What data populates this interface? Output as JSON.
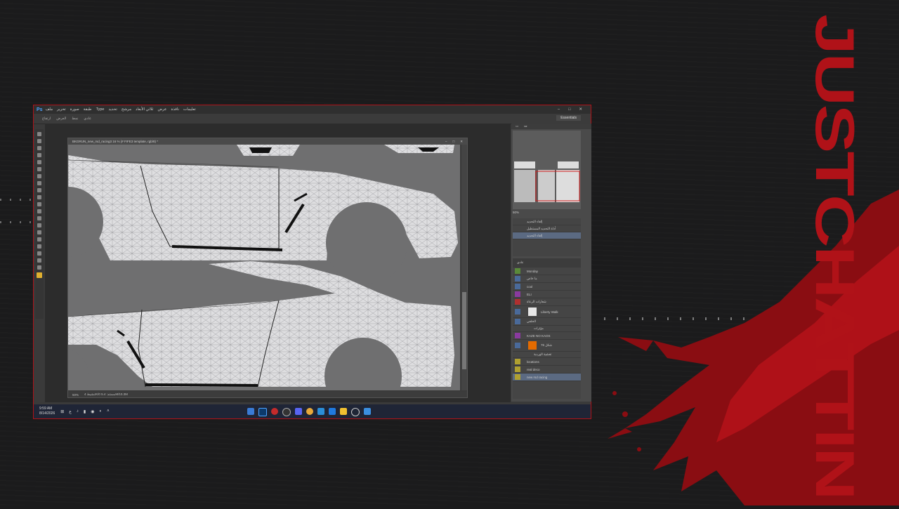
{
  "brand": {
    "text": "JUSTCHATTIN",
    "accent": "#b01218"
  },
  "photoshop": {
    "logo": "Ps",
    "menus": [
      "ملف",
      "تحرير",
      "صورة",
      "طبقة",
      "Type",
      "تحديد",
      "مرشح",
      "ثلاثي الأبعاد",
      "عرض",
      "نافذة",
      "تعليمات"
    ],
    "options": [
      "ارتفاع",
      "العرض",
      "نمط",
      "عادي"
    ],
    "workspace": "Essentials",
    "document_title": "BKGRUN_new_rsd_racing3 16 % (# FIFE3 template, rgb/8) *",
    "zoom": "50%",
    "status_info": "تنشيط 4K/0 مستند: 5.4M/10.3M",
    "navigator_zoom": "50%",
    "history_items": [
      "إلغاء التحديد",
      "أداة التحديد المستطيل",
      "إلغاء التحديد"
    ],
    "layers_mode": "عادي",
    "layers": [
      {
        "name": "Monday",
        "color": "#5a8a3a"
      },
      {
        "name": "ما خاص",
        "color": "#4a6a9a"
      },
      {
        "name": "cool",
        "color": "#4a6a9a"
      },
      {
        "name": "ELI",
        "color": "#8a3aa0"
      },
      {
        "name": "شعارات الرعاة",
        "color": "#b03030"
      },
      {
        "name": "Liberty Walk",
        "color": "#4a6a9a"
      },
      {
        "name": "الخلفي",
        "color": "#4a6a9a"
      },
      {
        "name": "KAZE NO KAOS",
        "color": "#8a3aa0"
      },
      {
        "name": "شكل 76",
        "color": "#4a6a9a"
      },
      {
        "name": "locations",
        "color": "#b0a030"
      },
      {
        "name": "real deco",
        "color": "#b0a030"
      },
      {
        "name": "new rsd racing",
        "color": "#b0a030"
      }
    ],
    "layer_effects": [
      "مؤثرات",
      "تغشية الوردية"
    ]
  },
  "taskbar": {
    "time": "9:59 AM",
    "date": "8/14/2026"
  }
}
